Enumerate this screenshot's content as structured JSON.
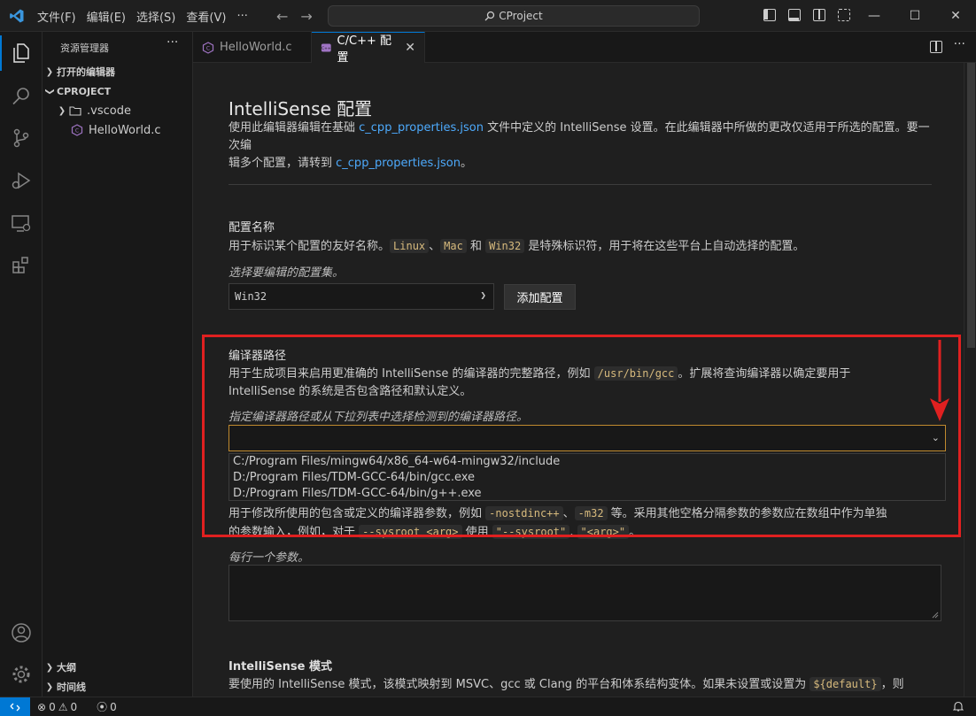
{
  "titlebar": {
    "menu": [
      "文件(F)",
      "编辑(E)",
      "选择(S)",
      "查看(V)",
      "···"
    ],
    "search_text": "CProject",
    "window_controls": [
      "—",
      "☐",
      "✕"
    ]
  },
  "sidebar": {
    "title": "资源管理器",
    "more": "···",
    "open_editors": "打开的编辑器",
    "project": "CPROJECT",
    "folder": ".vscode",
    "file": "HelloWorld.c",
    "outline": "大纲",
    "timeline": "时间线"
  },
  "tabs": [
    {
      "label": "HelloWorld.c"
    },
    {
      "label": "C/C++ 配置",
      "close": "✕"
    }
  ],
  "tabs_more": "···",
  "editor": {
    "title": "IntelliSense 配置",
    "intro_1": "使用此编辑器编辑在基础 ",
    "intro_link_1": "c_cpp_properties.json",
    "intro_2": " 文件中定义的 IntelliSense 设置。在此编辑器中所做的更改仅适用于所选的配置。要一次编",
    "intro_3": "辑多个配置，请转到 ",
    "intro_link_2": "c_cpp_properties.json",
    "intro_4": "。",
    "config_name": {
      "title": "配置名称",
      "desc_1": "用于标识某个配置的友好名称。",
      "code_linux": "Linux",
      "sep_1": "、",
      "code_mac": "Mac",
      "and": " 和 ",
      "code_win32": "Win32",
      "desc_2": " 是特殊标识符，用于将在这些平台上自动选择的配置。",
      "hint": "选择要编辑的配置集。",
      "selected": "Win32",
      "add_button": "添加配置"
    },
    "compiler_path": {
      "title": "编译器路径",
      "desc_1": "用于生成项目来启用更准确的 IntelliSense 的编译器的完整路径，例如 ",
      "code_example": "/usr/bin/gcc",
      "desc_2": "。扩展将查询编译器以确定要用于",
      "desc_3": "IntelliSense 的系统是否包含路径和默认定义。",
      "hint": "指定编译器路径或从下拉列表中选择检测到的编译器路径。",
      "value": "",
      "options": [
        "C:/Program Files/mingw64/x86_64-w64-mingw32/include",
        "D:/Program Files/TDM-GCC-64/bin/gcc.exe",
        "D:/Program Files/TDM-GCC-64/bin/g++.exe"
      ]
    },
    "compiler_args": {
      "desc_1": "用于修改所使用的包含或定义的编译器参数，例如 ",
      "code_1": "-nostdinc++",
      "sep": "、",
      "code_2": "-m32",
      "desc_2": " 等。采用其他空格分隔参数的参数应在数组中作为单独",
      "desc_3": "的参数输入，例如，对于 ",
      "code_3": "--sysroot <arg>",
      "desc_4": " 使用 ",
      "code_4": "\"--sysroot\"",
      "comma": ", ",
      "code_5": "\"<arg>\"",
      "desc_5": "。",
      "hint": "每行一个参数。"
    },
    "intellisense_mode": {
      "title": "IntelliSense 模式",
      "desc_1": "要使用的 IntelliSense 模式，该模式映射到 MSVC、gcc 或 Clang 的平台和体系结构变体。如果未设置或设置为 ",
      "code_default": "${default}",
      "desc_2": "，则"
    }
  },
  "statusbar": {
    "errors": "0",
    "warnings": "0",
    "ports": "0"
  },
  "colors": {
    "accent": "#0078d4",
    "highlight_box": "#e02020",
    "link": "#4daafc"
  }
}
